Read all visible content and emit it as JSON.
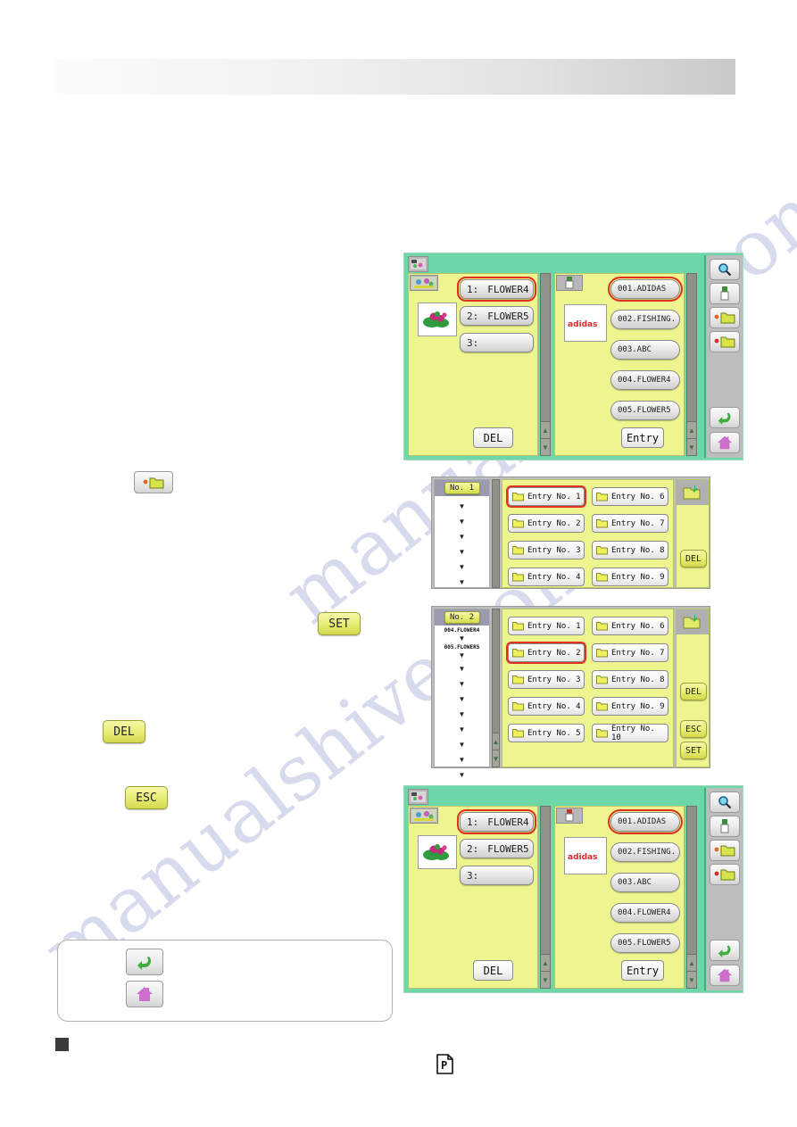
{
  "page": {
    "header_title": "",
    "watermark_lines": [
      "manualshive.com",
      "manualshive.com"
    ],
    "footer_mark": "P",
    "bullet": ""
  },
  "inline_buttons": {
    "folder_add": {
      "name": "folder-add-button",
      "label": ""
    },
    "set": {
      "label": "SET"
    },
    "del": {
      "label": "DEL"
    },
    "esc": {
      "label": "ESC"
    }
  },
  "note_box": {
    "back_label": "",
    "home_label": ""
  },
  "screen_select": {
    "left_panel": {
      "header_icon": "pattern-icon",
      "thumbnail_icon": "flower-embroidery",
      "items": [
        {
          "index": "1:",
          "name": "FLOWER4",
          "selected": true
        },
        {
          "index": "2:",
          "name": "FLOWER5",
          "selected": false
        },
        {
          "index": "3:",
          "name": "",
          "selected": false
        }
      ],
      "del_label": "DEL"
    },
    "right_panel": {
      "header_icon": "memory-icon",
      "thumbnail_icon": "adidas-logo",
      "items": [
        {
          "name": "001.ADIDAS",
          "selected": true
        },
        {
          "name": "002.FISHING.",
          "selected": false
        },
        {
          "name": "003.ABC",
          "selected": false
        },
        {
          "name": "004.FLOWER4",
          "selected": false
        },
        {
          "name": "005.FLOWER5",
          "selected": false
        }
      ],
      "entry_label": "Entry"
    },
    "toolbar": [
      {
        "icon": "search-icon"
      },
      {
        "icon": "usb-memory-icon"
      },
      {
        "icon": "folder-open-icon-1"
      },
      {
        "icon": "folder-open-icon-2"
      },
      {
        "icon": "back-icon"
      },
      {
        "icon": "home-icon"
      }
    ]
  },
  "screen_entry_1": {
    "title": "No. 1",
    "list_items": [],
    "arrow_count": 6,
    "entries_col1": [
      "Entry No. 1",
      "Entry No. 2",
      "Entry No. 3",
      "Entry No. 4"
    ],
    "entries_col2": [
      "Entry No. 6",
      "Entry No. 7",
      "Entry No. 8",
      "Entry No. 9"
    ],
    "selected_entry": "Entry No. 1",
    "header_icon": "folder-save-icon",
    "buttons": [
      {
        "label": "DEL"
      }
    ]
  },
  "screen_entry_2": {
    "title": "No. 2",
    "list_items": [
      "004.FLOWER4",
      "005.FLOWER5"
    ],
    "arrow_count": 9,
    "entries_col1": [
      "Entry No. 1",
      "Entry No. 2",
      "Entry No. 3",
      "Entry No. 4",
      "Entry No. 5"
    ],
    "entries_col2": [
      "Entry No. 6",
      "Entry No. 7",
      "Entry No. 8",
      "Entry No. 9",
      "Entry No. 10"
    ],
    "selected_entry": "Entry No. 2",
    "header_icon": "folder-save-icon",
    "buttons": [
      {
        "label": "DEL"
      },
      {
        "label": "ESC"
      },
      {
        "label": "SET"
      }
    ]
  },
  "screen_select_2": {
    "left_panel": {
      "items": [
        {
          "index": "1:",
          "name": "FLOWER4",
          "selected": true
        },
        {
          "index": "2:",
          "name": "FLOWER5",
          "selected": false
        },
        {
          "index": "3:",
          "name": "",
          "selected": false
        }
      ],
      "del_label": "DEL"
    },
    "right_panel": {
      "items": [
        {
          "name": "001.ADIDAS",
          "selected": true
        },
        {
          "name": "002.FISHING.",
          "selected": false
        },
        {
          "name": "003.ABC",
          "selected": false
        },
        {
          "name": "004.FLOWER4",
          "selected": false
        },
        {
          "name": "005.FLOWER5",
          "selected": false
        }
      ],
      "entry_label": "Entry"
    }
  },
  "colors": {
    "device_bg": "#6ed7a8",
    "panel_bg": "#eef58f",
    "selection_red": "#e03020",
    "button_yellow": "#e7ec72",
    "header_gray": "#a9a9a9"
  }
}
